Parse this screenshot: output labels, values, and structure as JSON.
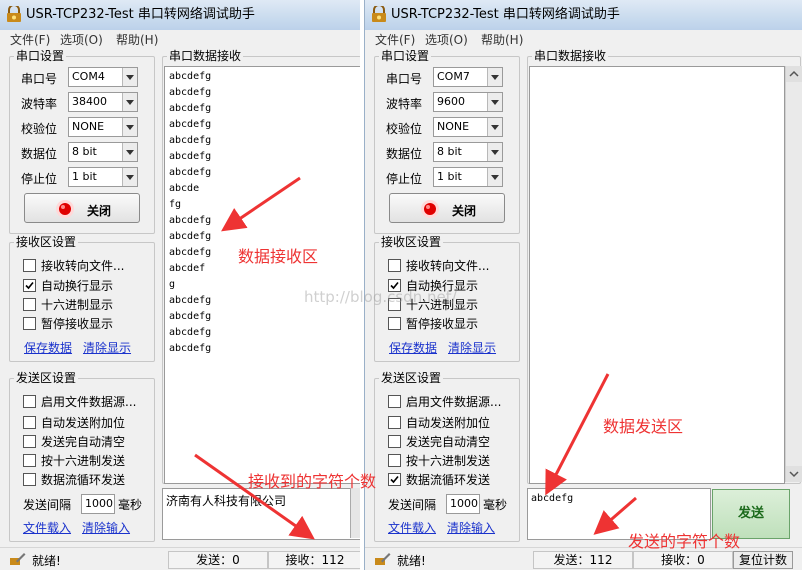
{
  "left": {
    "title": "USR-TCP232-Test 串口转网络调试助手",
    "menu": [
      "文件(F)",
      "选项(O)",
      "帮助(H)"
    ],
    "serial_group_title": "串口设置",
    "serial_labels": [
      "串口号",
      "波特率",
      "校验位",
      "数据位",
      "停止位"
    ],
    "serial_values": [
      "COM4",
      "38400",
      "NONE",
      "8 bit",
      "1 bit"
    ],
    "close_button": "关闭",
    "rx_group_title": "接收区设置",
    "rx_options": [
      "接收转向文件...",
      "自动换行显示",
      "十六进制显示",
      "暂停接收显示"
    ],
    "rx_checked": [
      false,
      true,
      false,
      false
    ],
    "rx_links": [
      "保存数据",
      "清除显示"
    ],
    "tx_group_title": "发送区设置",
    "tx_options": [
      "启用文件数据源...",
      "自动发送附加位",
      "发送完自动清空",
      "按十六进制发送",
      "数据流循环发送"
    ],
    "tx_checked": [
      false,
      false,
      false,
      false,
      false
    ],
    "interval_label": "发送间隔",
    "interval_value": "1000",
    "interval_unit": "毫秒",
    "tx_links": [
      "文件载入",
      "清除输入"
    ],
    "rx_area_title": "串口数据接收",
    "rx_lines": [
      "abcdefg",
      "abcdefg",
      "abcdefg",
      "abcdefg",
      "abcdefg",
      "abcdefg",
      "abcdefg",
      "abcde",
      "fg",
      "abcdefg",
      "abcdefg",
      "abcdefg",
      "abcdef",
      "g",
      "abcdefg",
      "abcdefg",
      "abcdefg",
      "abcdefg"
    ],
    "send_text": "济南有人科技有限公司",
    "status_ready": "就绪!",
    "status_sent": "发送：0",
    "status_recv": "接收：112"
  },
  "right": {
    "title": "USR-TCP232-Test 串口转网络调试助手",
    "menu": [
      "文件(F)",
      "选项(O)",
      "帮助(H)"
    ],
    "serial_group_title": "串口设置",
    "serial_labels": [
      "串口号",
      "波特率",
      "校验位",
      "数据位",
      "停止位"
    ],
    "serial_values": [
      "COM7",
      "9600",
      "NONE",
      "8 bit",
      "1 bit"
    ],
    "close_button": "关闭",
    "rx_group_title": "接收区设置",
    "rx_options": [
      "接收转向文件...",
      "自动换行显示",
      "十六进制显示",
      "暂停接收显示"
    ],
    "rx_checked": [
      false,
      true,
      false,
      false
    ],
    "rx_links": [
      "保存数据",
      "清除显示"
    ],
    "tx_group_title": "发送区设置",
    "tx_options": [
      "启用文件数据源...",
      "自动发送附加位",
      "发送完自动清空",
      "按十六进制发送",
      "数据流循环发送"
    ],
    "tx_checked": [
      false,
      false,
      false,
      false,
      true
    ],
    "interval_label": "发送间隔",
    "interval_value": "1000",
    "interval_unit": "毫秒",
    "tx_links": [
      "文件载入",
      "清除输入"
    ],
    "rx_area_title": "串口数据接收",
    "send_text": "abcdefg",
    "send_button": "发送",
    "status_ready": "就绪!",
    "status_sent": "发送：112",
    "status_recv": "接收：0",
    "status_reset": "复位计数"
  },
  "annotations": {
    "rx_area": "数据接收区",
    "rx_count": "接收到的字符个数",
    "tx_area": "数据发送区",
    "tx_count": "发送的字符个数"
  },
  "watermark": "http://blog.csdn.net/",
  "colors": {
    "annotation_red": "#ee3333",
    "link_blue": "#1a32cc",
    "send_button_green": "#1b6a1b"
  }
}
